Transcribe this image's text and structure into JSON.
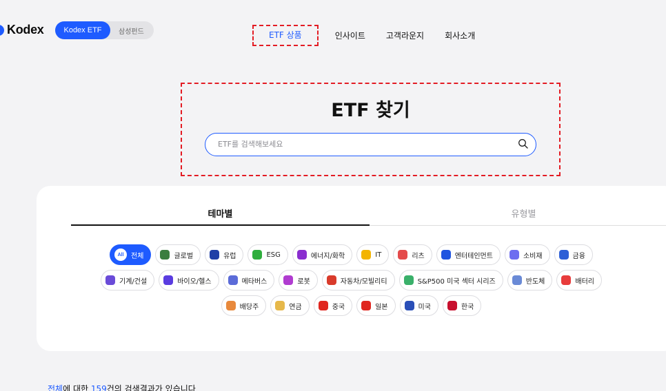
{
  "header": {
    "logo_text": "Kodex",
    "brand_active": "Kodex ETF",
    "brand_inactive": "삼성펀드",
    "nav": [
      "ETF 상품",
      "인사이트",
      "고객라운지",
      "회사소개"
    ]
  },
  "search": {
    "title": "ETF 찾기",
    "placeholder": "ETF를 검색해보세요",
    "value": ""
  },
  "tabs": [
    "테마별",
    "유형별"
  ],
  "chips": {
    "row1": [
      {
        "label": "전체",
        "icon": "all-icon",
        "badge": "All",
        "color": "#ffffff"
      },
      {
        "label": "글로벌",
        "icon": "globe-icon",
        "color": "#3a7d3f"
      },
      {
        "label": "유럽",
        "icon": "eu-flag-icon",
        "color": "#1f3fa6"
      },
      {
        "label": "ESG",
        "icon": "leaf-icon",
        "color": "#2fae3d"
      },
      {
        "label": "에너지/화학",
        "icon": "plug-icon",
        "color": "#8a2ecf"
      },
      {
        "label": "IT",
        "icon": "bulb-icon",
        "color": "#f3b400"
      },
      {
        "label": "리츠",
        "icon": "building-icon",
        "color": "#e44b4b"
      },
      {
        "label": "엔터테인먼트",
        "icon": "play-icon",
        "color": "#2055e0"
      },
      {
        "label": "소비재",
        "icon": "cart-icon",
        "color": "#6d6df0"
      },
      {
        "label": "금융",
        "icon": "money-bag-icon",
        "color": "#2d5fd6"
      }
    ],
    "row2": [
      {
        "label": "기계/건설",
        "icon": "factory-icon",
        "color": "#6a4bd8"
      },
      {
        "label": "바이오/헬스",
        "icon": "dna-icon",
        "color": "#5a3ce0"
      },
      {
        "label": "메타버스",
        "icon": "metaverse-icon",
        "color": "#5b6bd8"
      },
      {
        "label": "로봇",
        "icon": "robot-arm-icon",
        "color": "#b03cd0"
      },
      {
        "label": "자동차/모빌리티",
        "icon": "car-icon",
        "color": "#d93b2b"
      },
      {
        "label": "S&P500 미국 섹터 시리즈",
        "icon": "dots-grid-icon",
        "color": "#3ab06a"
      },
      {
        "label": "반도체",
        "icon": "chip-icon",
        "color": "#6a8ad6"
      },
      {
        "label": "배터리",
        "icon": "battery-icon",
        "color": "#e83c3c"
      }
    ],
    "row3": [
      {
        "label": "배당주",
        "icon": "calendar-icon",
        "color": "#e8893c"
      },
      {
        "label": "연금",
        "icon": "coin-icon",
        "color": "#e6b84a"
      },
      {
        "label": "중국",
        "icon": "china-flag-icon",
        "color": "#e0261f"
      },
      {
        "label": "일본",
        "icon": "japan-flag-icon",
        "color": "#e0261f"
      },
      {
        "label": "미국",
        "icon": "us-flag-icon",
        "color": "#2a4fb8"
      },
      {
        "label": "한국",
        "icon": "korea-flag-icon",
        "color": "#c8102e"
      }
    ]
  },
  "result": {
    "prefix": "전체",
    "middle": "에 대한 ",
    "count": "159",
    "suffix": "건의 검색결과가 있습니다"
  },
  "colors": {
    "accent": "#1e5bff",
    "highlight_border": "#e31b23"
  }
}
